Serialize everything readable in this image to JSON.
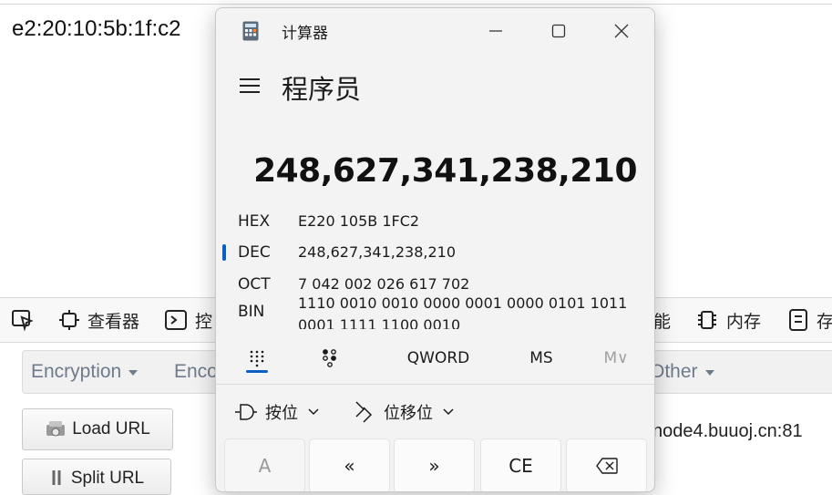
{
  "background": {
    "mac_address_text": "e2:20:10:5b:1f:c2",
    "devtools": {
      "inspector_label": "查看器",
      "console_label": "控",
      "performance_label": "能",
      "memory_label": "内存",
      "storage_label": "存"
    },
    "hackbar": {
      "encryption": "Encryption",
      "encoding": "Enco",
      "other": "Other"
    },
    "buttons": {
      "load_url": "Load URL",
      "split_url": "Split URL"
    },
    "url_text": "node4.buuoj.cn:81"
  },
  "calculator": {
    "window_title": "计算器",
    "mode_title": "程序员",
    "display_value": "248,627,341,238,210",
    "radix": [
      {
        "label": "HEX",
        "value": "E220 105B 1FC2"
      },
      {
        "label": "DEC",
        "value": "248,627,341,238,210",
        "selected": true
      },
      {
        "label": "OCT",
        "value": "7 042 002 026 617 702"
      },
      {
        "label": "BIN",
        "value": "1110 0010 0010 0000 0001 0000 0101 1011 0001 1111 1100 0010"
      }
    ],
    "tabs": {
      "word_size": "QWORD",
      "memory_store": "MS",
      "memory_recall": "M∨"
    },
    "ops": {
      "bitwise": "按位",
      "bit_shift": "位移位"
    },
    "keys": {
      "a": "A",
      "lsh": "«",
      "rsh": "»",
      "clear_entry": "CE",
      "backspace": "⌫"
    },
    "colors": {
      "accent": "#0a5fbf"
    }
  }
}
